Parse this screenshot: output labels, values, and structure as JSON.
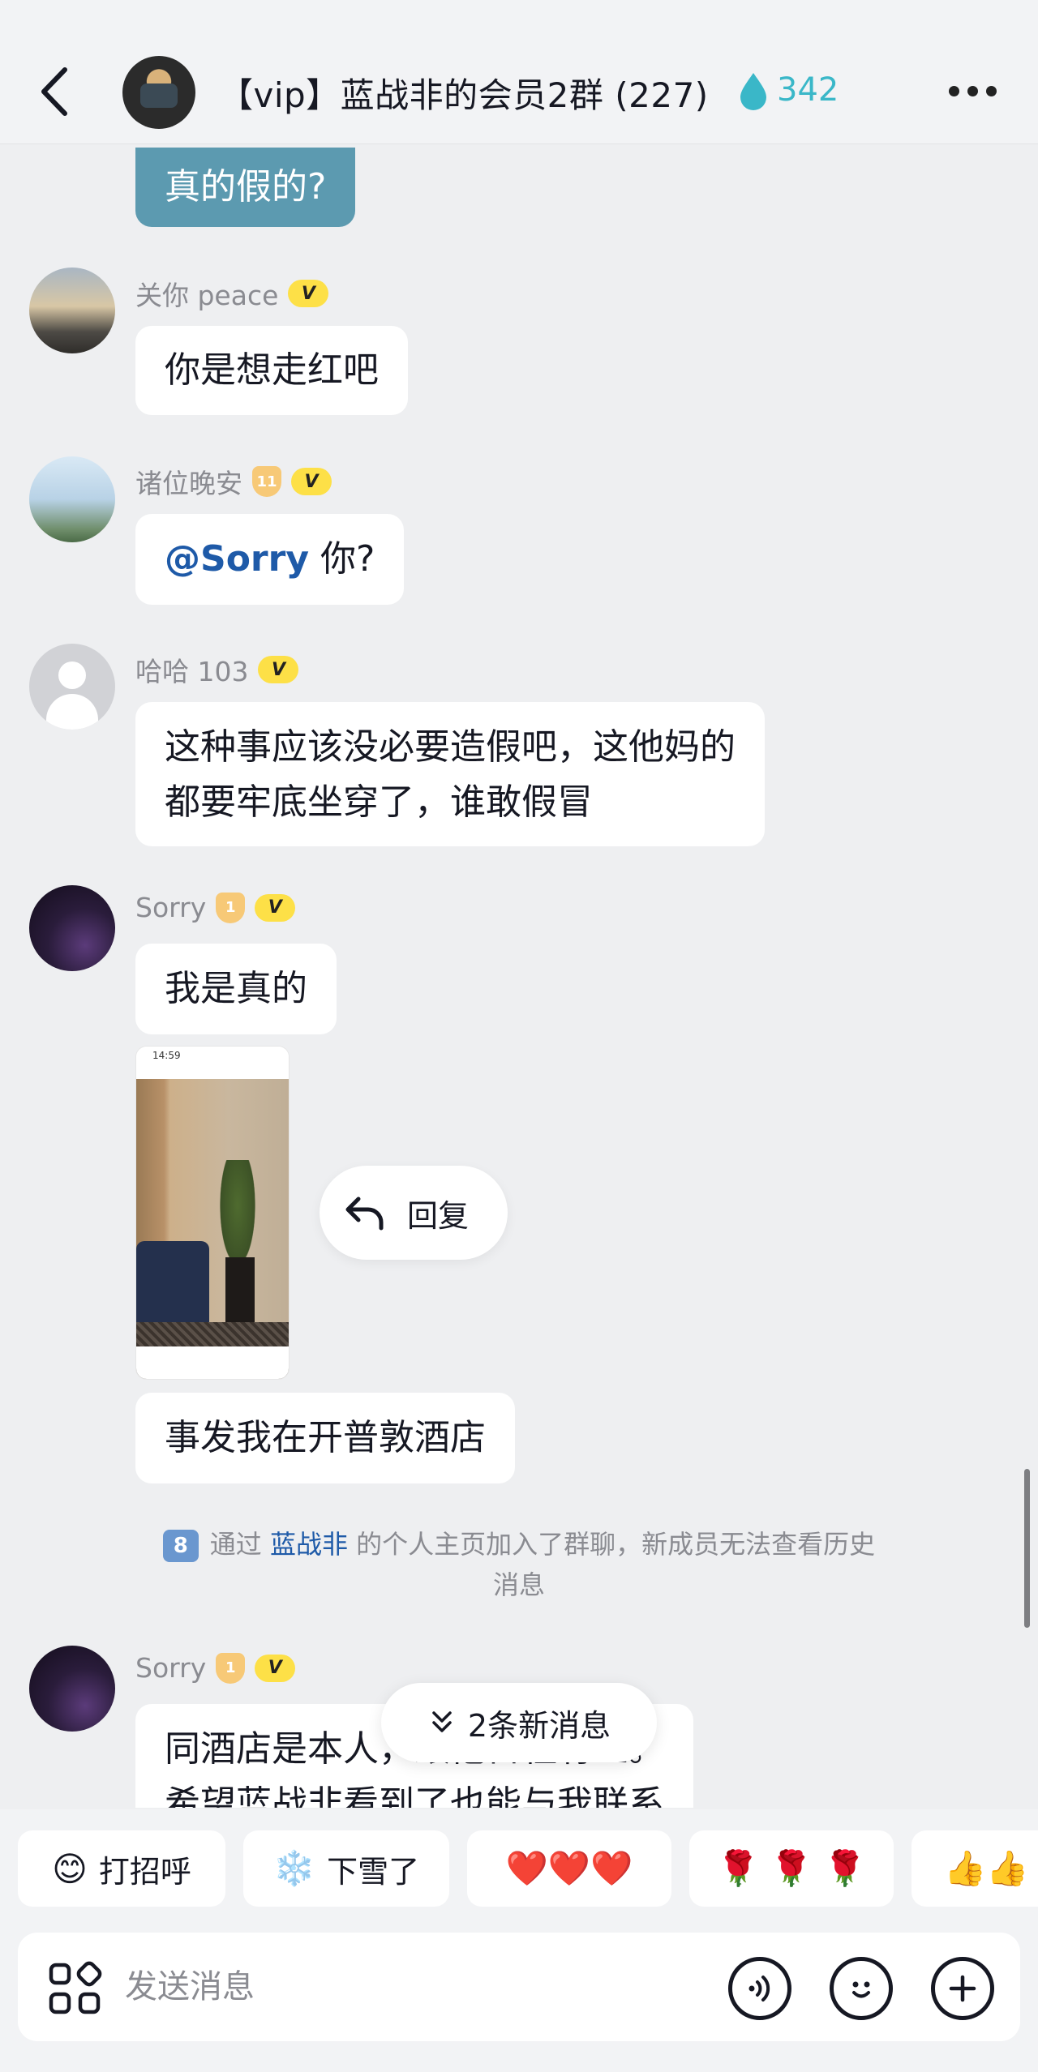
{
  "header": {
    "title": "【vip】蓝战非的会员2群 (227)",
    "heat_count": "342",
    "accent_color": "#3ab7c8"
  },
  "messages": [
    {
      "own": true,
      "text": "真的假的?"
    },
    {
      "sender": "关你 peace",
      "v_badge": "V",
      "text": "你是想走红吧"
    },
    {
      "sender": "诸位晚安",
      "level_badge": "11",
      "v_badge": "V",
      "mention": "@Sorry",
      "text": " 你?"
    },
    {
      "sender": "哈哈 103",
      "v_badge": "V",
      "lines": [
        "这种事应该没必要造假吧，这他妈的",
        "都要牢底坐穿了，谁敢假冒"
      ]
    },
    {
      "sender": "Sorry",
      "level_badge": "1",
      "v_badge": "V",
      "text": "我是真的",
      "text2": "事发我在开普敦酒店"
    },
    {
      "sender": "Sorry",
      "level_badge": "1",
      "v_badge": "V",
      "lines": [
        "同酒店是本人，跟他日程有差。",
        "希望蓝战非看到了也能与我联系"
      ]
    }
  ],
  "photo": {
    "status_time": "14:59"
  },
  "reply_action": {
    "label": "回复"
  },
  "system_notice": {
    "badge": "8",
    "prefix": "通过",
    "link": "蓝战非",
    "line1_suffix": "的个人主页加入了群聊，新成员无法查看历史",
    "line2": "消息"
  },
  "new_messages": {
    "label": "2条新消息"
  },
  "quick_replies": [
    {
      "icon": "smile-emoji-icon",
      "emoji": "😊",
      "label": "打招呼"
    },
    {
      "icon": "snowflake-icon",
      "emoji": "❄️",
      "label": "下雪了"
    },
    {
      "icon": "hearts-icon",
      "emoji": "❤️❤️❤️",
      "label": ""
    },
    {
      "icon": "roses-icon",
      "emoji": "🌹 🌹 🌹",
      "label": ""
    },
    {
      "icon": "thumbs-up-icon",
      "emoji": "👍👍",
      "label": ""
    }
  ],
  "input": {
    "placeholder": "发送消息"
  },
  "colors": {
    "background": "#eeeff1",
    "bubble": "#ffffff",
    "own_bubble": "#5c9ab0",
    "mention": "#1e5aa8",
    "v_badge": "#fde047"
  }
}
